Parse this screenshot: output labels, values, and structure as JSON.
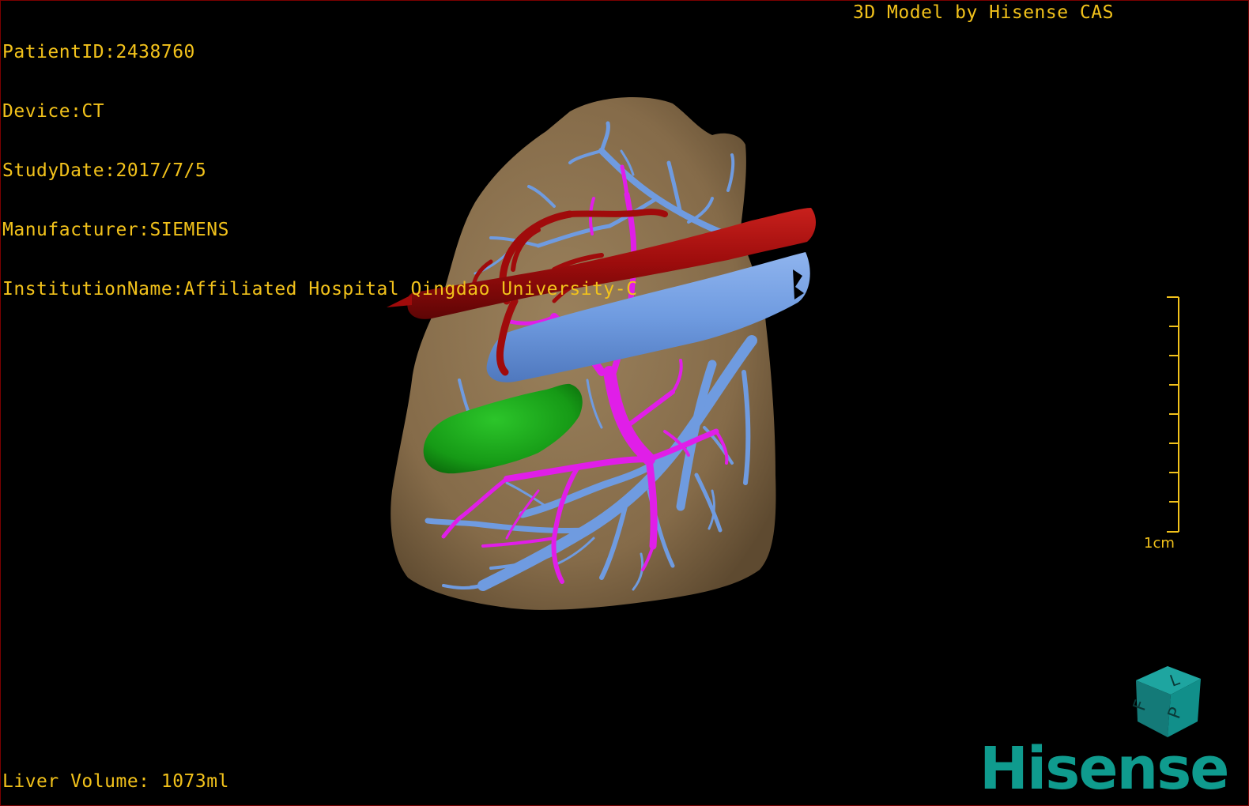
{
  "overlay": {
    "patient_id": "PatientID:2438760",
    "device": "Device:CT",
    "study_date": "StudyDate:2017/7/5",
    "manufacturer": "Manufacturer:SIEMENS",
    "institution": "InstitutionName:Affiliated Hospital Qingdao University-C",
    "model_credit": "3D Model by Hisense CAS",
    "liver_volume": "Liver Volume: 1073ml"
  },
  "scale_bar": {
    "label": "1cm"
  },
  "orientation_cube": {
    "faces": [
      "F",
      "L",
      "P"
    ]
  },
  "logo": {
    "text": "Hisense"
  },
  "colors": {
    "overlay_text": "#f2c21b",
    "liver": "#8a7150",
    "hepatic_artery": "#a00b0b",
    "portal_vein": "#e01ee8",
    "hepatic_vein": "#6f9be0",
    "gallbladder": "#14a015",
    "brand": "#0f9b8e",
    "border": "#7a0000"
  }
}
